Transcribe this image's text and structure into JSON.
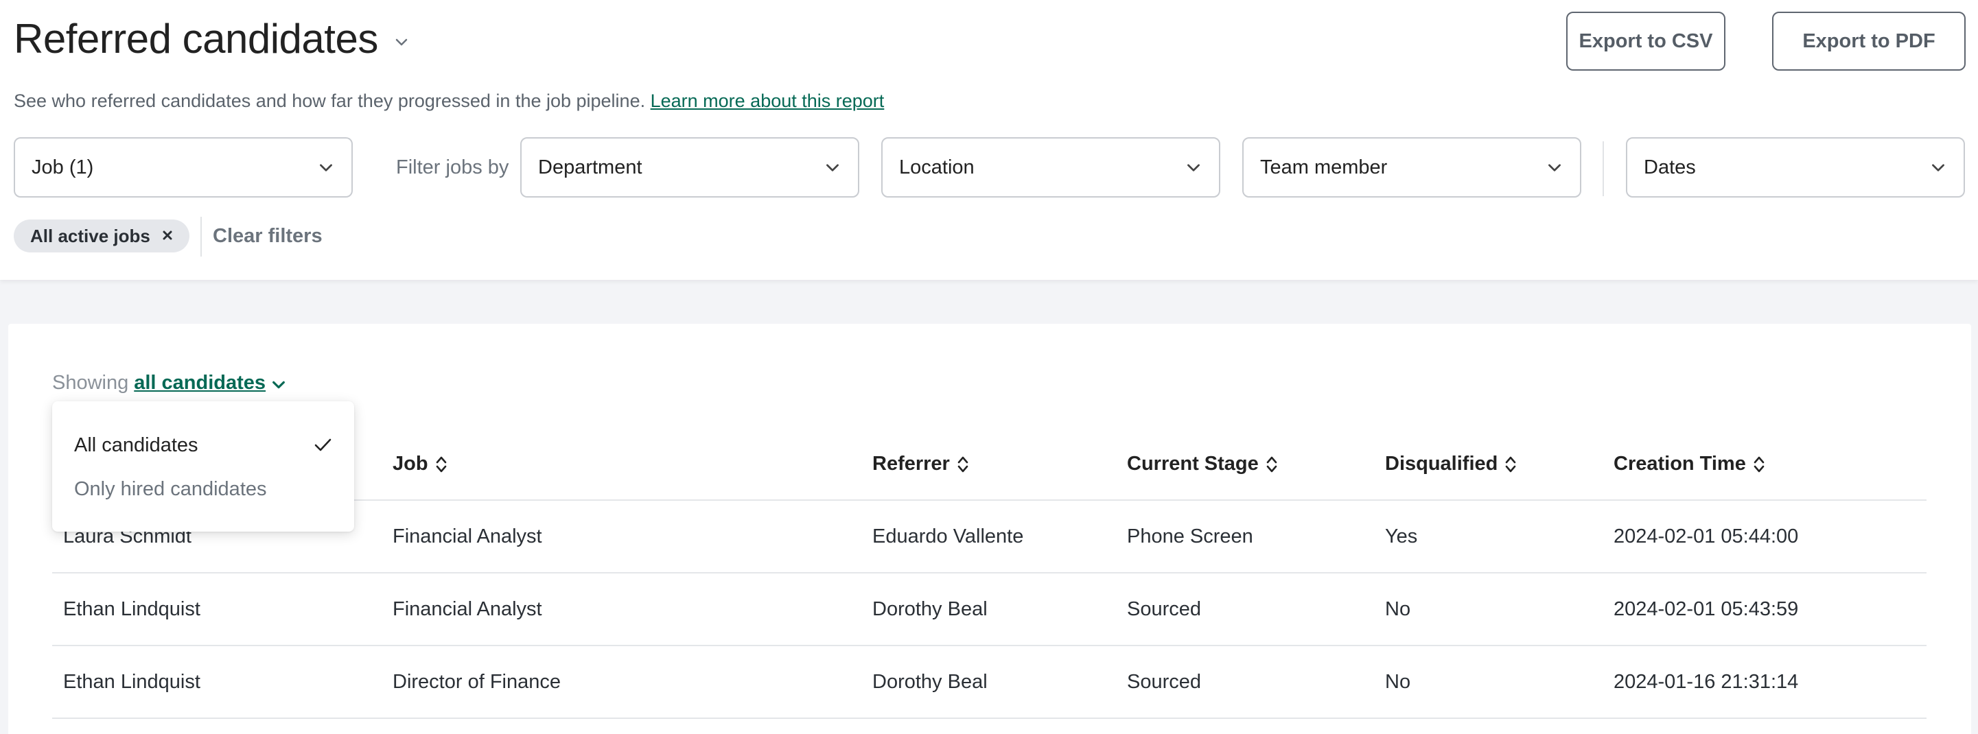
{
  "header": {
    "title": "Referred candidates",
    "subtitle": "See who referred candidates and how far they progressed in the job pipeline.",
    "learn_more": "Learn more about this report",
    "export_csv": "Export to CSV",
    "export_pdf": "Export to PDF"
  },
  "filters": {
    "job": "Job (1)",
    "filter_by_label": "Filter jobs by",
    "department": "Department",
    "location": "Location",
    "team_member": "Team member",
    "dates": "Dates",
    "active_chip": "All active jobs",
    "clear": "Clear filters"
  },
  "results": {
    "showing_prefix": "Showing",
    "showing_value": "all candidates",
    "dropdown_options": [
      {
        "label": "All candidates",
        "selected": true
      },
      {
        "label": "Only hired candidates",
        "selected": false
      }
    ],
    "columns": [
      "Job",
      "Referrer",
      "Current Stage",
      "Disqualified",
      "Creation Time"
    ],
    "rows": [
      {
        "name": "Laura Schmidt",
        "job": "Financial Analyst",
        "referrer": "Eduardo Vallente",
        "stage": "Phone Screen",
        "disqualified": "Yes",
        "created": "2024-02-01 05:44:00"
      },
      {
        "name": "Ethan Lindquist",
        "job": "Financial Analyst",
        "referrer": "Dorothy Beal",
        "stage": "Sourced",
        "disqualified": "No",
        "created": "2024-02-01 05:43:59"
      },
      {
        "name": "Ethan Lindquist",
        "job": "Director of Finance",
        "referrer": "Dorothy Beal",
        "stage": "Sourced",
        "disqualified": "No",
        "created": "2024-01-16 21:31:14"
      }
    ]
  },
  "colors": {
    "accent": "#066955",
    "border": "#c9ccd1",
    "background": "#f3f4f7"
  },
  "icons": {
    "title_dropdown": "chevron-down-icon",
    "select": "chevron-down-icon",
    "chip_remove": "close-icon",
    "sort": "sort-icon",
    "selected": "checkmark-icon"
  }
}
